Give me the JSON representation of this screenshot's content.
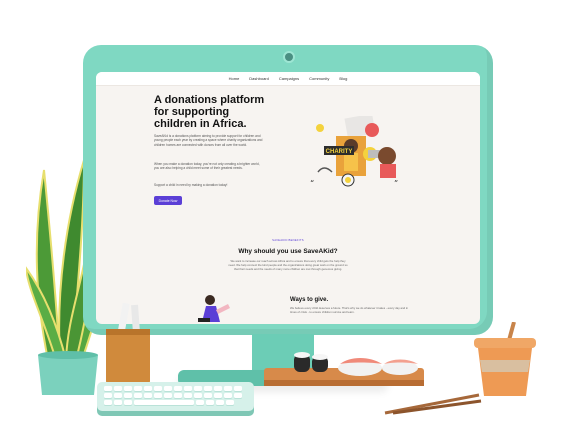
{
  "website": {
    "nav": [
      "Home",
      "Dashboard",
      "Campaigns",
      "Community",
      "Blog"
    ],
    "hero": {
      "title": "A donations platform for supporting children in Africa.",
      "p1": "SaveAKid is a donations platform aiming to provide support for children and young people each year by creating a space where charity organizations and children homes are connected with donors from all over the world.",
      "p2": "When you make a donation today, you're not only creating a brighter world, you are also helping a child meet some of their greatest needs.",
      "p3": "Support a child in need by making a donation today!",
      "cta": "Donate Now"
    },
    "section": {
      "kicker": "SAVEAKID BENEFITS",
      "title": "Why should you use SaveAKid?",
      "body": "We want to increase our reach across Africa and to ensure that every child gets the help they need. We help connect the kind people and the organizations doing great work on the ground so that their needs and the needs of many more children are met through generous giving."
    },
    "ways": {
      "title": "Ways to give.",
      "body": "We believe every child deserves a future. That's why we do whatever it takes - every day and in times of crisis - to ensure children survive and learn."
    },
    "illustration_badge": "CHARITY"
  },
  "colors": {
    "monitor": "#7fd8c2",
    "screen": "#f7f4f1",
    "accent": "#5b3fd6",
    "plant": "#4f9a3a",
    "cup": "#ee9a54"
  }
}
